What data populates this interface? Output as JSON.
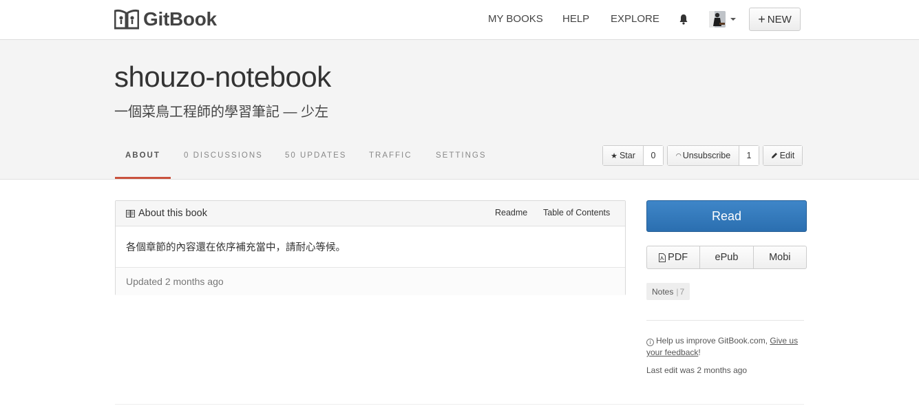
{
  "brand": {
    "name": "GitBook"
  },
  "nav": {
    "my_books": "MY BOOKS",
    "help": "HELP",
    "explore": "EXPLORE",
    "new_label": "NEW"
  },
  "book": {
    "title": "shouzo-notebook",
    "subtitle": "一個菜鳥工程師的學習筆記 — 少左"
  },
  "tabs": [
    "ABOUT",
    "0 DISCUSSIONS",
    "50 UPDATES",
    "TRAFFIC",
    "SETTINGS"
  ],
  "actions": {
    "star_label": "Star",
    "star_count": "0",
    "unsubscribe_label": "Unsubscribe",
    "unsubscribe_count": "1",
    "edit_label": "Edit"
  },
  "about": {
    "title": "About this book",
    "readme_link": "Readme",
    "toc_link": "Table of Contents",
    "description": "各個章節的內容還在依序補充當中，請耐心等候。",
    "updated": "Updated 2 months ago"
  },
  "sidebar": {
    "read_label": "Read",
    "formats": [
      "PDF",
      "ePub",
      "Mobi"
    ],
    "notes_label": "Notes",
    "notes_count": "7",
    "feedback_text": "Help us improve GitBook.com,",
    "feedback_link": "Give us your feedback",
    "feedback_end": "!",
    "last_edit": "Last edit was 2 months ago"
  },
  "colors": {
    "accent_tab": "#c9513d",
    "read_button": "#3478bb"
  }
}
